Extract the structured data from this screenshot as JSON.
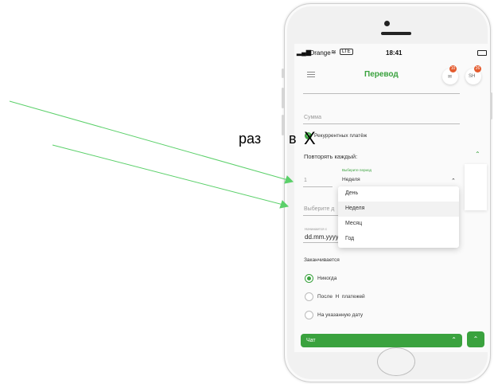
{
  "status_bar": {
    "carrier": "Orange",
    "network": "LTE",
    "time": "18:41"
  },
  "header": {
    "title": "Перевод",
    "badge_left": "10",
    "badge_right": "26",
    "right_label": "SH"
  },
  "form": {
    "amount_placeholder": "Сумма",
    "recurring_label": "Рекуррентных платёж",
    "repeat_label": "Повторять каждый:",
    "period_hint": "Выберите период",
    "period_value": "Неделя",
    "count_value": "1",
    "select_placeholder": "Выберите д",
    "start_hint": "Начинается с",
    "start_value": "dd.mm.yyyy",
    "ends_label": "Заканчивается",
    "options": [
      {
        "label": "Никогда",
        "selected": true
      },
      {
        "label": "После  Н  платежей",
        "selected": false
      },
      {
        "label": "На указанную дату",
        "selected": false
      }
    ]
  },
  "dropdown": {
    "items": [
      "День",
      "Неделя",
      "Месяц",
      "Год"
    ],
    "selected": "Неделя"
  },
  "chat": {
    "label": "Чат"
  },
  "annotation": {
    "text_1": "раз",
    "text_2": "в",
    "text_3": "X",
    "arrow_color": "#5bd06a"
  },
  "colors": {
    "accent": "#3aa23e",
    "badge": "#e45b2e"
  }
}
